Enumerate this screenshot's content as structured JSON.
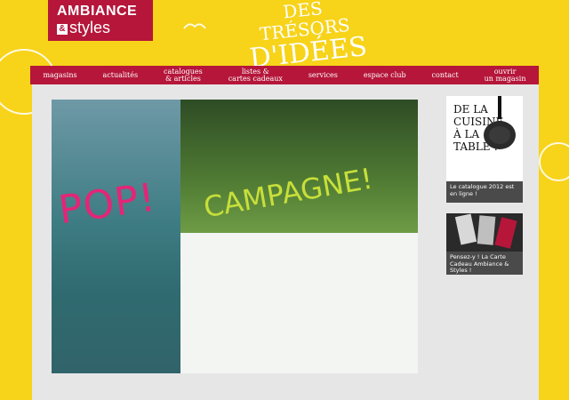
{
  "brand": {
    "logo_line1": "AMBIANCE",
    "logo_line2": "styles",
    "logo_amp": "&"
  },
  "header": {
    "tagline_line1": "DES TRÉSORS",
    "tagline_line2": "D'IDÉES !"
  },
  "nav": {
    "items": [
      "magasins",
      "actualités",
      "catalogues\n& articles",
      "listes &\ncartes cadeaux",
      "services",
      "espace club",
      "contact",
      "ouvrir\nun magasin"
    ]
  },
  "hero": {
    "headline_left": "POP!",
    "headline_right": "CAMPAGNE!"
  },
  "sidebar": {
    "card1_title_lines": [
      "DE LA",
      "CUISINE",
      "À LA",
      "TABLE !"
    ],
    "card1_caption": "Le catalogue 2012 est en ligne !",
    "card2_caption": "Pensez-y ! La Carte Cadeau Ambiance & Styles !"
  },
  "colors": {
    "background_yellow": "#f7d31a",
    "brand_red": "#b5163a",
    "pop_pink": "#e42577",
    "campagne_green": "#c7df3a",
    "content_gray": "#e6e6e6"
  }
}
